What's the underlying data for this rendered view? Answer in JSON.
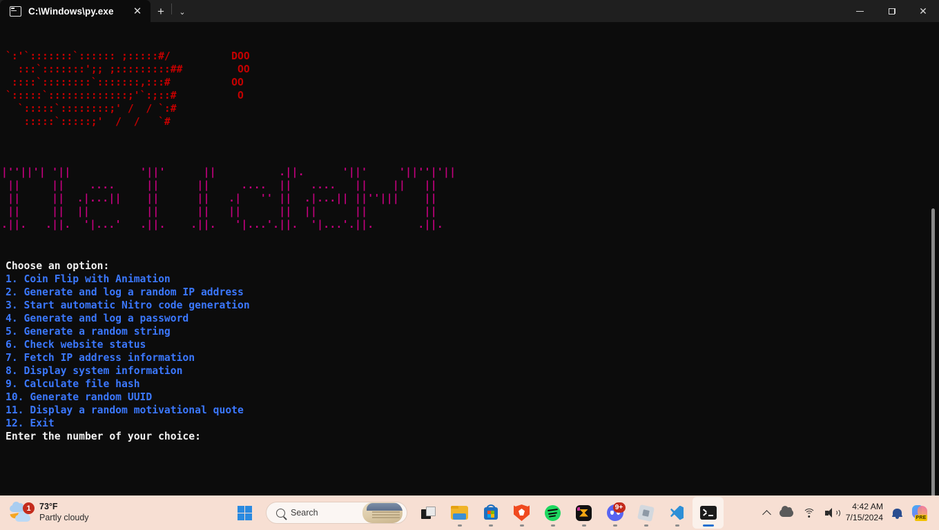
{
  "window": {
    "tab_title": "C:\\Windows\\py.exe",
    "tab_icon": "console-icon",
    "close_label": "✕",
    "newtab_label": "+",
    "dropdown_label": "⌄",
    "minimize_label": "",
    "restore_label": "",
    "window_close_label": "✕"
  },
  "console": {
    "background": "#0c0c0c",
    "art_red_color": "#c40000",
    "art_magenta_color": "#c4007e",
    "prompt_color": "#f2f2f2",
    "menu_color": "#3b78ff",
    "art_red": "`:'`:::::::`:::::: ;:::::#/          DOO\n  :::`:::::::';; ;:::::::::##         OO\n ::::`::::::::`:::::::,:::#          OO\n`:::::`:::::::::::::;'`:;::#          O\n  `:::::`::::::::;' /  / `:#\n   :::::`:::::;'  /  /   `#",
    "art_magenta": "|''||'| '||           '||'      ||          .||.      '||'     '||''|'||\n ||     ||    ....     ||      ||     ....  ||   ....   ||    ||   ||\n ||     ||  .|...||    ||      ||   .|   '' ||  .|...|| ||''|||    ||\n ||     ||  ||         ||      ||   ||      ||  ||      ||         ||\n.||.   .||.  '|...'   .||.    .||.   '|...'.||.  '|...'.||.       .||.",
    "menu_heading": "Choose an option:",
    "menu_items": [
      "1. Coin Flip with Animation",
      "2. Generate and log a random IP address",
      "3. Start automatic Nitro code generation",
      "4. Generate and log a password",
      "5. Generate a random string",
      "6. Check website status",
      "7. Fetch IP address information",
      "8. Display system information",
      "9. Calculate file hash",
      "10. Generate random UUID",
      "11. Display a random motivational quote",
      "12. Exit"
    ],
    "prompt": "Enter the number of your choice:"
  },
  "taskbar": {
    "background": "#f7dfd3",
    "weather": {
      "temperature": "73°F",
      "condition": "Partly cloudy",
      "badge": "1"
    },
    "start_label": "start-button",
    "search": {
      "placeholder": "Search",
      "icon": "search-icon"
    },
    "apps": [
      {
        "name": "task-view",
        "running": false
      },
      {
        "name": "file-explorer",
        "running": true
      },
      {
        "name": "microsoft-store",
        "running": true
      },
      {
        "name": "brave-browser",
        "running": true
      },
      {
        "name": "spotify",
        "running": true
      },
      {
        "name": "bow-app",
        "running": true
      },
      {
        "name": "discord",
        "running": true,
        "badge": "9+"
      },
      {
        "name": "roblox",
        "running": true
      },
      {
        "name": "visual-studio-code",
        "running": true
      },
      {
        "name": "windows-terminal",
        "running": true,
        "active": true
      }
    ],
    "tray": {
      "chevron": "show-hidden-icons",
      "cloud": "onedrive-icon",
      "wifi": "wifi-icon",
      "volume": "volume-icon",
      "time": "4:42 AM",
      "date": "7/15/2024",
      "bell": "notifications-icon",
      "copilot": "copilot-icon",
      "copilot_badge": "PRE"
    }
  }
}
